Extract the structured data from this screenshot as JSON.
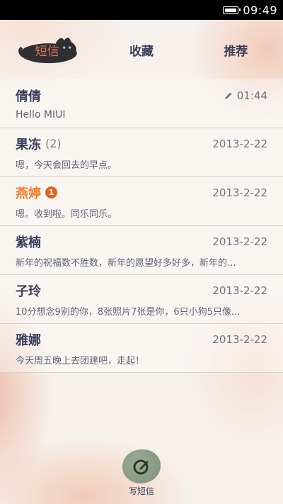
{
  "status_bar": {
    "time": "09:49",
    "battery_icon": "battery-icon"
  },
  "tabs": [
    {
      "label": "短信",
      "active": true
    },
    {
      "label": "收藏",
      "active": false
    },
    {
      "label": "推荐",
      "active": false
    }
  ],
  "conversations": [
    {
      "name": "倩倩",
      "count": "",
      "badge": "",
      "time": "01:44",
      "draft": true,
      "preview": "Hello MIUI"
    },
    {
      "name": "果冻",
      "count": "(2)",
      "badge": "",
      "time": "2013-2-22",
      "draft": false,
      "preview": "嗯，今天会回去的早点。"
    },
    {
      "name": "燕婷",
      "count": "",
      "badge": "1",
      "time": "2013-2-22",
      "draft": false,
      "preview": "嗯。收到啦。同乐同乐。"
    },
    {
      "name": "紫楠",
      "count": "",
      "badge": "",
      "time": "2013-2-22",
      "draft": false,
      "preview": "新年的祝福数不胜数，新年的愿望好多好多，新年的..."
    },
    {
      "name": "子玲",
      "count": "",
      "badge": "",
      "time": "2013-2-22",
      "draft": false,
      "preview": "10分想念9别的你，8张照片7张是你，6只小狗5只像..."
    },
    {
      "name": "雅娜",
      "count": "",
      "badge": "",
      "time": "2013-2-22",
      "draft": false,
      "preview": "今天周五晚上去团建吧，走起！"
    }
  ],
  "compose": {
    "label": "写短信",
    "icon": "compose-icon"
  },
  "colors": {
    "accent": "#e2735c",
    "unread": "#ef7d2e",
    "badge": "#e4601f",
    "text": "#3a3e5c"
  }
}
